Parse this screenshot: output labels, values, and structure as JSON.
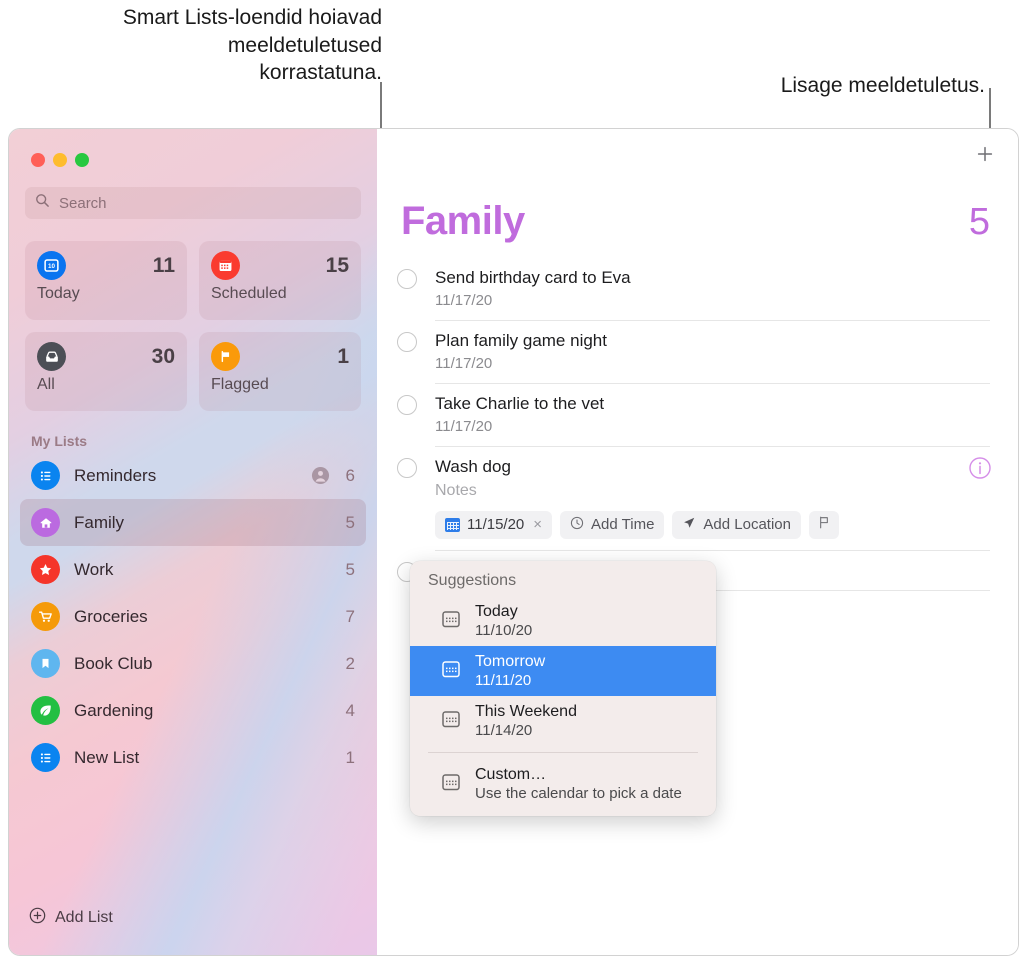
{
  "callouts": {
    "left": "Smart Lists-loendid hoiavad\nmeeldetuletused\nkorrastatuna.",
    "right": "Lisage meeldetuletus."
  },
  "window": {
    "traffic_lights": [
      "close-red",
      "minimize-yellow",
      "zoom-green"
    ]
  },
  "sidebar": {
    "search": {
      "placeholder": "Search",
      "icon": "search-icon"
    },
    "smart_lists": [
      {
        "label": "Today",
        "count": "11",
        "icon": "calendar-day-icon",
        "color": "#0a74f0"
      },
      {
        "label": "Scheduled",
        "count": "15",
        "icon": "calendar-icon",
        "color": "#fa3b2f"
      },
      {
        "label": "All",
        "count": "30",
        "icon": "inbox-tray-icon",
        "color": "#4c4f56"
      },
      {
        "label": "Flagged",
        "count": "1",
        "icon": "flag-icon",
        "color": "#fa9a0a"
      }
    ],
    "my_lists_header": "My Lists",
    "lists": [
      {
        "name": "Reminders",
        "count": "6",
        "icon": "bulleted-list-icon",
        "color": "#0a84f0",
        "shared": true,
        "selected": false
      },
      {
        "name": "Family",
        "count": "5",
        "icon": "home-icon",
        "color": "#bb6ae0",
        "shared": false,
        "selected": true
      },
      {
        "name": "Work",
        "count": "5",
        "icon": "star-icon",
        "color": "#f5352a",
        "shared": false,
        "selected": false
      },
      {
        "name": "Groceries",
        "count": "7",
        "icon": "shopping-cart-icon",
        "color": "#f59a09",
        "shared": false,
        "selected": false
      },
      {
        "name": "Book Club",
        "count": "2",
        "icon": "bookmark-icon",
        "color": "#5fb6ef",
        "shared": false,
        "selected": false
      },
      {
        "name": "Gardening",
        "count": "4",
        "icon": "leaf-icon",
        "color": "#23bf42",
        "shared": false,
        "selected": false
      },
      {
        "name": "New List",
        "count": "1",
        "icon": "bulleted-list-icon",
        "color": "#0a84f0",
        "shared": false,
        "selected": false
      }
    ],
    "add_list": {
      "label": "Add List",
      "icon": "plus-circle-icon"
    }
  },
  "main": {
    "add_reminder": {
      "icon": "plus-icon"
    },
    "title": "Family",
    "title_color": "#c06cdd",
    "total": "5",
    "reminders": [
      {
        "title": "Send birthday card to Eva",
        "date": "11/17/20",
        "editing": false
      },
      {
        "title": "Plan family game night",
        "date": "11/17/20",
        "editing": false
      },
      {
        "title": "Take Charlie to the vet",
        "date": "11/17/20",
        "editing": false
      },
      {
        "title": "Wash dog",
        "notes_placeholder": "Notes",
        "editing": true
      },
      {
        "title": "",
        "date": "",
        "editing": false
      }
    ],
    "editor": {
      "date_chip": {
        "value": "11/15/20",
        "icon": "calendar-icon",
        "clear": "×"
      },
      "add_time": {
        "label": "Add Time",
        "icon": "clock-icon"
      },
      "add_location": {
        "label": "Add Location",
        "icon": "location-arrow-icon"
      },
      "flag_button": {
        "icon": "flag-outline-icon"
      },
      "info_button": {
        "icon": "info-circle-icon",
        "color": "#d58ee8"
      }
    }
  },
  "suggestions": {
    "header": "Suggestions",
    "items": [
      {
        "title": "Today",
        "subtitle": "11/10/20",
        "icon": "calendar-icon",
        "active": false
      },
      {
        "title": "Tomorrow",
        "subtitle": "11/11/20",
        "icon": "calendar-icon",
        "active": true
      },
      {
        "title": "This Weekend",
        "subtitle": "11/14/20",
        "icon": "calendar-icon",
        "active": false
      }
    ],
    "custom": {
      "title": "Custom…",
      "subtitle": "Use the calendar to pick a date",
      "icon": "calendar-icon"
    }
  }
}
